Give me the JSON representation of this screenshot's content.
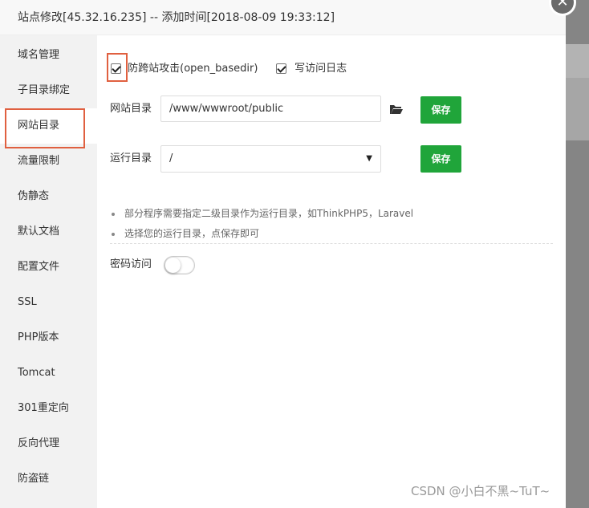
{
  "dialog": {
    "title": "站点修改[45.32.16.235] -- 添加时间[2018-08-09 19:33:12]",
    "close_glyph": "✕"
  },
  "sidebar": {
    "items": [
      {
        "label": "域名管理",
        "active": false
      },
      {
        "label": "子目录绑定",
        "active": false
      },
      {
        "label": "网站目录",
        "active": true
      },
      {
        "label": "流量限制",
        "active": false
      },
      {
        "label": "伪静态",
        "active": false
      },
      {
        "label": "默认文档",
        "active": false
      },
      {
        "label": "配置文件",
        "active": false
      },
      {
        "label": "SSL",
        "active": false
      },
      {
        "label": "PHP版本",
        "active": false
      },
      {
        "label": "Tomcat",
        "active": false
      },
      {
        "label": "301重定向",
        "active": false
      },
      {
        "label": "反向代理",
        "active": false
      },
      {
        "label": "防盗链",
        "active": false
      }
    ]
  },
  "options": {
    "anti_xss": {
      "label": "防跨站攻击(open_basedir)",
      "checked": true
    },
    "access_log": {
      "label": "写访问日志",
      "checked": true
    }
  },
  "site_dir": {
    "label": "网站目录",
    "value": "/www/wwwroot/public",
    "save_label": "保存",
    "icon": "folder-open-icon"
  },
  "run_dir": {
    "label": "运行目录",
    "selected": "/",
    "save_label": "保存"
  },
  "notes": [
    "部分程序需要指定二级目录作为运行目录，如ThinkPHP5，Laravel",
    "选择您的运行目录，点保存即可"
  ],
  "password_access": {
    "label": "密码访问",
    "enabled": false
  },
  "watermark": "CSDN @小白不黑~TuT~",
  "colors": {
    "primary_green": "#20a53a",
    "highlight_red": "#e06040",
    "sidebar_bg": "#f2f2f2"
  }
}
